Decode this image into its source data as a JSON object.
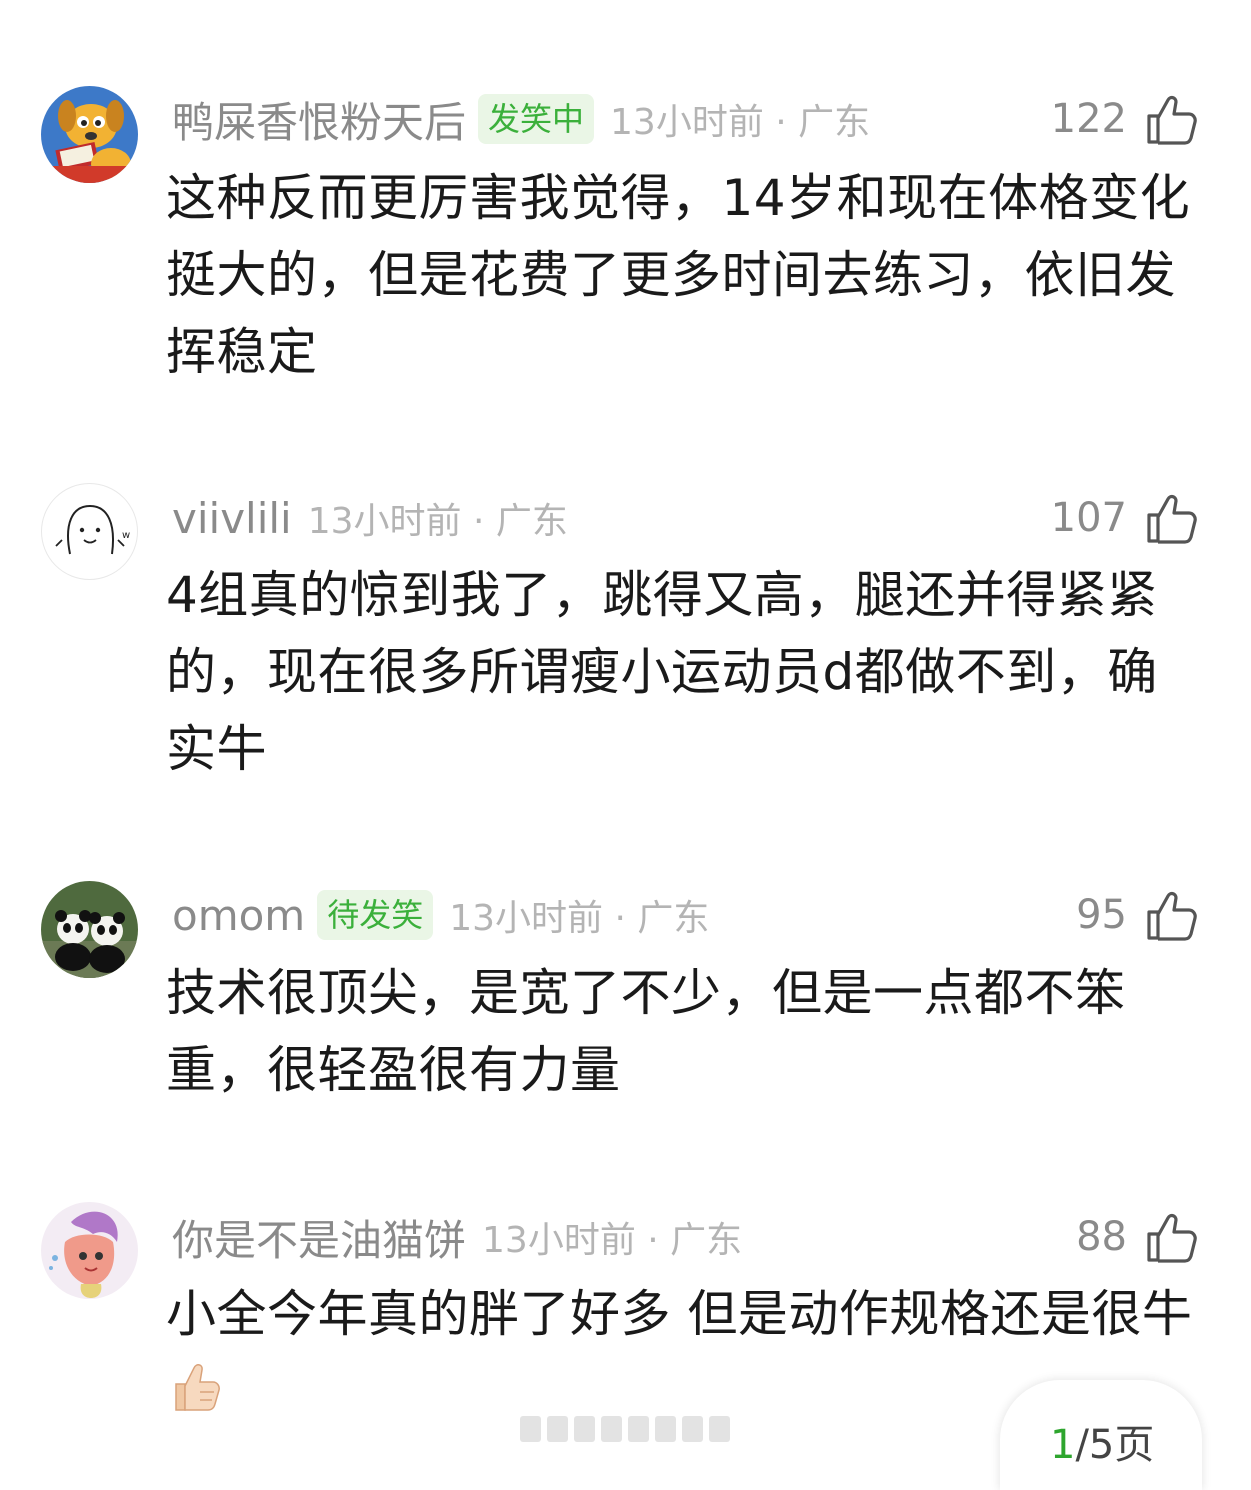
{
  "comments": [
    {
      "username": "鸭屎香恨粉天后",
      "badge": "发笑中",
      "time": "13小时前 · 广东",
      "likes": "122",
      "text": "这种反而更厉害我觉得，14岁和现在体格变化挺大的，但是花费了更多时间去练习，依旧发挥稳定",
      "avatar_icon": "cartoon-dog-avatar"
    },
    {
      "username": "viivlili",
      "time": "13小时前 · 广东",
      "likes": "107",
      "text": "4组真的惊到我了，跳得又高，腿还并得紧紧的，现在很多所谓瘦小运动员d都做不到，确实牛",
      "avatar_icon": "doodle-face-avatar"
    },
    {
      "username": "omom",
      "badge": "待发笑",
      "time": "13小时前 · 广东",
      "likes": "95",
      "text": "技术很顶尖，是宽了不少，但是一点都不笨重，很轻盈很有力量",
      "avatar_icon": "panda-photo-avatar"
    },
    {
      "username": "你是不是油猫饼",
      "time": "13小时前 · 广东",
      "likes": "88",
      "text": "小全今年真的胖了好多 但是动作规格还是很牛",
      "emoji": "thumbs-up",
      "avatar_icon": "anime-girl-avatar"
    }
  ],
  "pager": {
    "current": "1",
    "rest": "/5页"
  },
  "colors": {
    "accent": "#2ea52e",
    "badge_bg": "#eaf6e6",
    "meta_text": "#8a8a8a"
  }
}
